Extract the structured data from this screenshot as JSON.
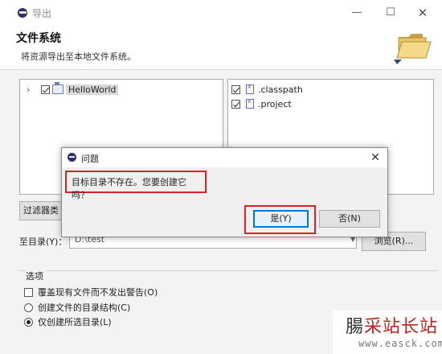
{
  "window": {
    "title": "导出",
    "minimize_glyph": "—",
    "maximize_glyph": "☐",
    "close_glyph": "✕"
  },
  "header": {
    "title": "文件系统",
    "subtitle": "将资源导出至本地文件系统。",
    "icon": "folder-icon"
  },
  "left_panel": {
    "items": [
      {
        "label": "HelloWorld",
        "checked": true,
        "expanded": false,
        "icon": "project-folder-icon",
        "chevron": "›"
      }
    ]
  },
  "right_panel": {
    "items": [
      {
        "label": ".classpath",
        "checked": true,
        "icon": "file-icon"
      },
      {
        "label": ".project",
        "checked": true,
        "icon": "file-icon"
      }
    ]
  },
  "filter_button_label": "过滤器类型",
  "destination": {
    "label": "至目录(Y)：",
    "value": "D:\\test",
    "browse_label": "浏览(R)..."
  },
  "options": {
    "title": "选项",
    "overwrite_label": "覆盖现有文件而不发出警告(O)",
    "overwrite_checked": false,
    "create_structure_label": "创建文件的目录结构(C)",
    "create_selected_label": "仅创建所选目录(L)",
    "selected_option": "create_selected"
  },
  "dialog": {
    "title": "问题",
    "message": "目标目录不存在。您要创建它吗？",
    "yes_label": "是(Y)",
    "no_label": "否(N)",
    "close_glyph": "✕",
    "highlight_color": "#d8232a",
    "focus_color": "#0078d7"
  },
  "watermark": {
    "text_first": "腸",
    "text_rest": "采站长站",
    "url": "www.easck.com"
  }
}
